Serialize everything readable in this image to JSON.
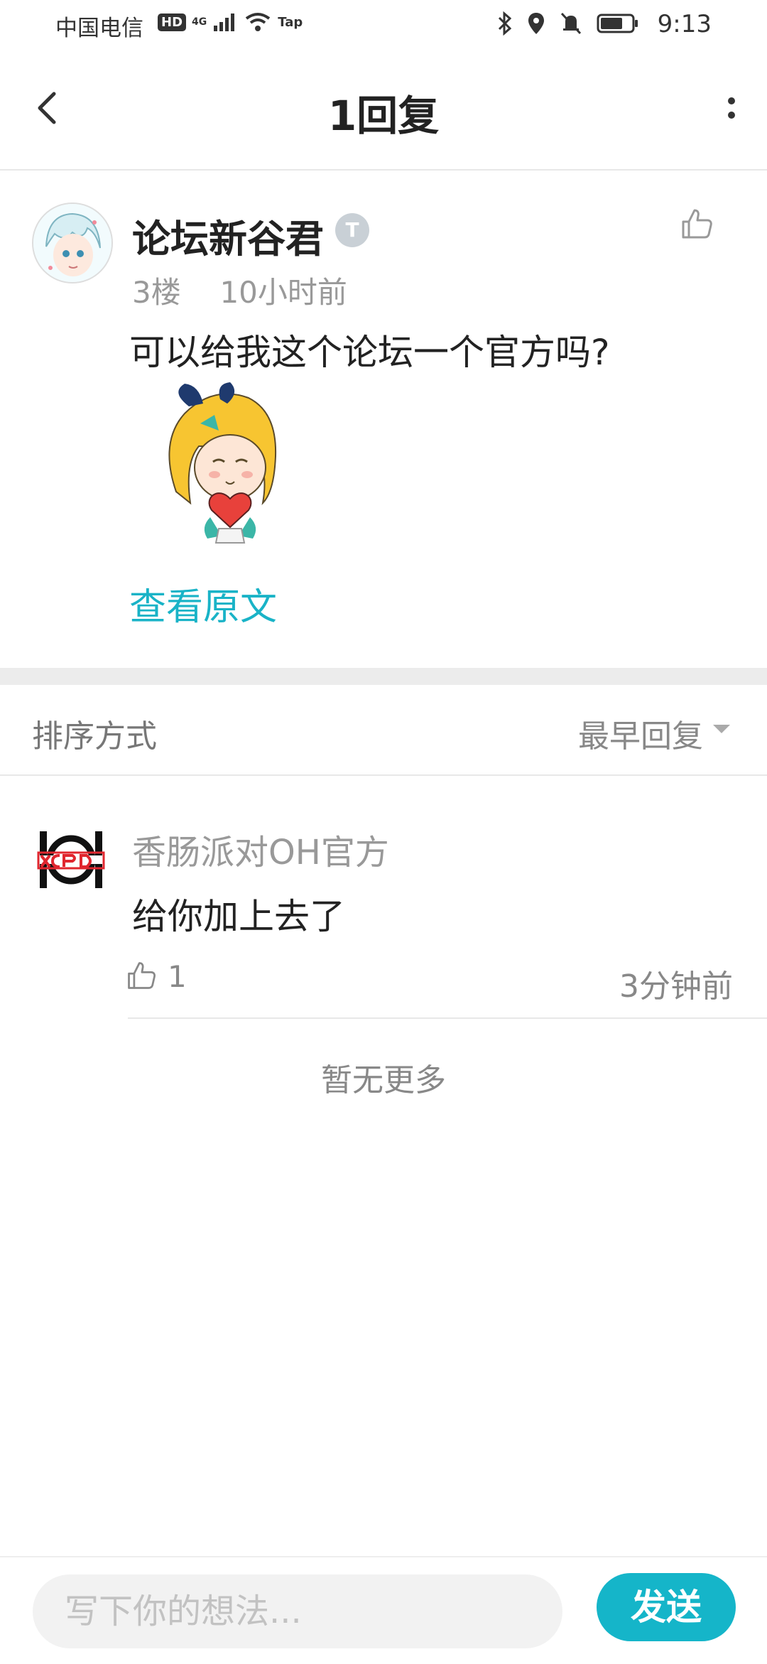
{
  "status_bar": {
    "carrier": "中国电信",
    "hd_badge": "HD",
    "network": "4G",
    "tap_label": "Tap",
    "time": "9:13"
  },
  "header": {
    "title": "1回复"
  },
  "post": {
    "author": "论坛新谷君",
    "level_badge": "T",
    "floor": "3楼",
    "time_ago": "10小时前",
    "body": "可以给我这个论坛一个官方吗?",
    "view_original": "查看原文"
  },
  "sort": {
    "label": "排序方式",
    "value": "最早回复"
  },
  "replies": [
    {
      "author": "香肠派对OH官方",
      "body": "给你加上去了",
      "likes": "1",
      "time_ago": "3分钟前"
    }
  ],
  "no_more": "暂无更多",
  "composer": {
    "placeholder": "写下你的想法...",
    "send_label": "发送"
  },
  "colors": {
    "accent": "#15b5c9",
    "link": "#19b3c7"
  }
}
